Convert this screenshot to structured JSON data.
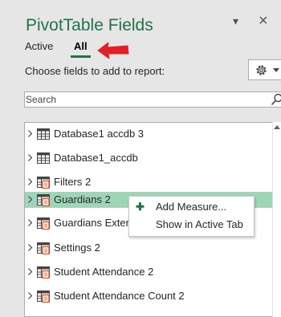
{
  "pane": {
    "title": "PivotTable Fields",
    "pane_options_glyph": "▾",
    "close_glyph": "×"
  },
  "tabs": [
    {
      "label": "Active",
      "selected": false
    },
    {
      "label": "All",
      "selected": true
    }
  ],
  "choose_label": "Choose fields to add to report:",
  "search": {
    "placeholder": "Search",
    "value": ""
  },
  "fields": [
    {
      "label": "Database1 accdb  3",
      "icon": "table-icon",
      "selected": false
    },
    {
      "label": "Database1_accdb",
      "icon": "table-icon",
      "selected": false
    },
    {
      "label": "Filters  2",
      "icon": "table-linked-icon",
      "selected": false
    },
    {
      "label": "Guardians  2",
      "icon": "table-linked-icon",
      "selected": true
    },
    {
      "label": "Guardians Extend",
      "icon": "table-linked-icon",
      "selected": false
    },
    {
      "label": "Settings  2",
      "icon": "table-linked-icon",
      "selected": false
    },
    {
      "label": "Student Attendance  2",
      "icon": "table-linked-icon",
      "selected": false
    },
    {
      "label": "Student Attendance Count  2",
      "icon": "table-linked-icon",
      "selected": false
    }
  ],
  "context_menu": {
    "items": [
      {
        "label": "Add Measure...",
        "icon": "plus-icon"
      },
      {
        "label": "Show in Active Tab",
        "icon": ""
      }
    ]
  },
  "colors": {
    "accent": "#217346",
    "selection": "#9fd5b7",
    "annotation_arrow": "#e31e24",
    "pane_background": "#e6e6e6"
  }
}
